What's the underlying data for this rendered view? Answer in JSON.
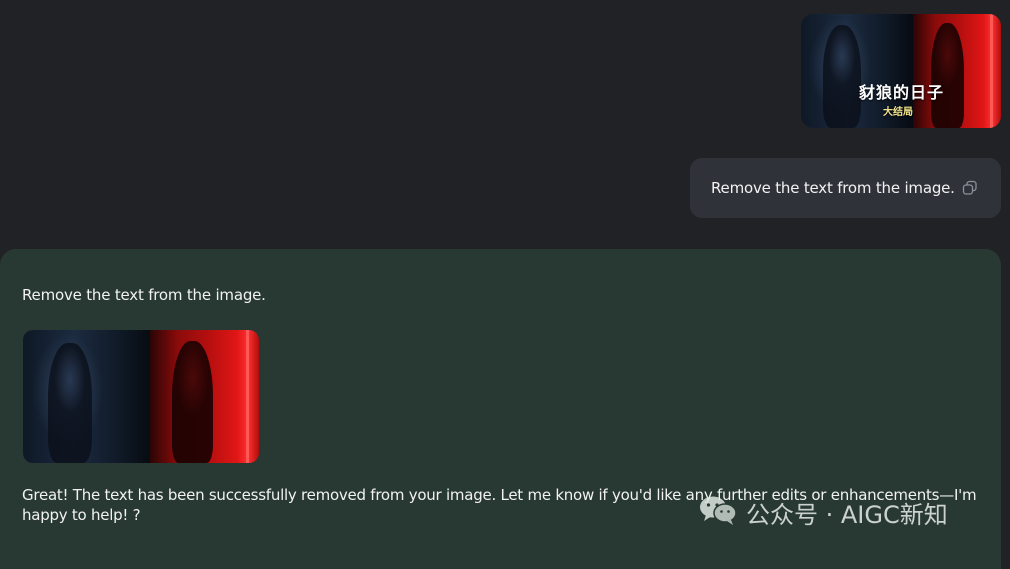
{
  "user_message": {
    "image": {
      "overlay_title": "豺狼的日子",
      "overlay_subtitle": "大结局"
    },
    "text": "Remove the text from the image.",
    "copy_icon": "copy-icon"
  },
  "assistant_message": {
    "echo_prompt": "Remove the text from the image.",
    "reply": "Great! The text has been successfully removed from your image. Let me know if you'd like any further edits or enhancements—I'm happy to help! ?"
  },
  "watermark": {
    "icon": "wechat-icon",
    "text": "公众号 · AIGC新知"
  },
  "colors": {
    "background": "#212226",
    "user_bubble": "#30323a",
    "assistant_panel": "#283833",
    "text": "#f2f2f2"
  }
}
